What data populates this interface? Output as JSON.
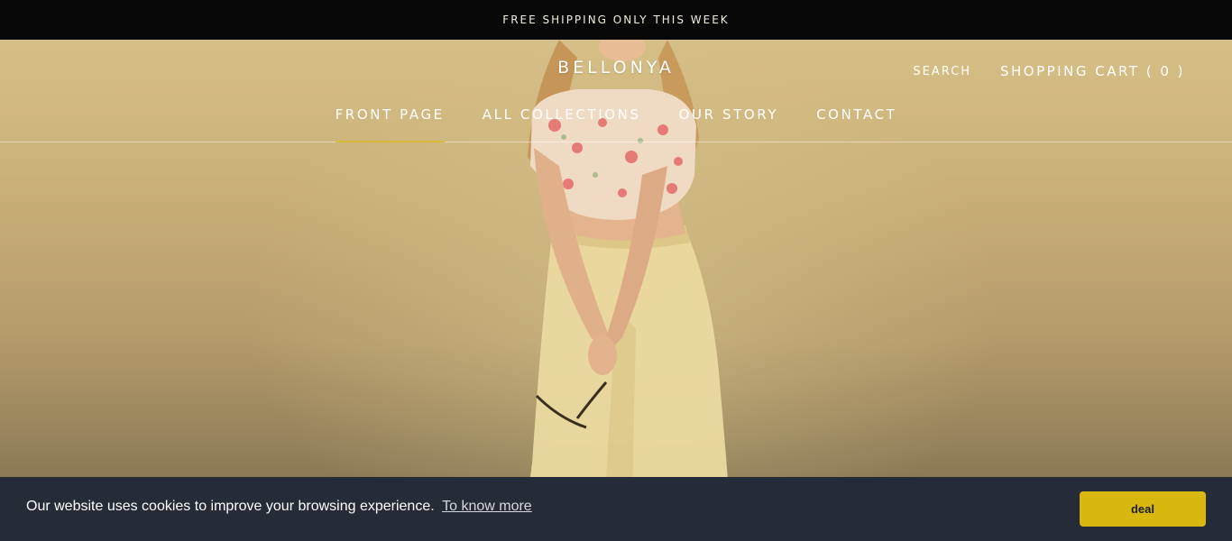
{
  "announcement": {
    "text": "FREE SHIPPING ONLY THIS WEEK"
  },
  "header": {
    "logo": "BELLONYA",
    "search_label": "SEARCH",
    "cart_label": "SHOPPING CART ( 0 )"
  },
  "nav": {
    "items": [
      {
        "label": "FRONT PAGE",
        "active": true
      },
      {
        "label": "ALL COLLECTIONS",
        "active": false
      },
      {
        "label": "OUR STORY",
        "active": false
      },
      {
        "label": "CONTACT",
        "active": false
      }
    ]
  },
  "cookie": {
    "message": "Our website uses cookies to improve your browsing experience.",
    "link_label": "To know more",
    "button_label": "deal"
  },
  "colors": {
    "announcement_bg": "#080808",
    "accent": "#d8b93c",
    "cookie_bg": "#252b37",
    "cookie_button": "#d8b70f"
  }
}
